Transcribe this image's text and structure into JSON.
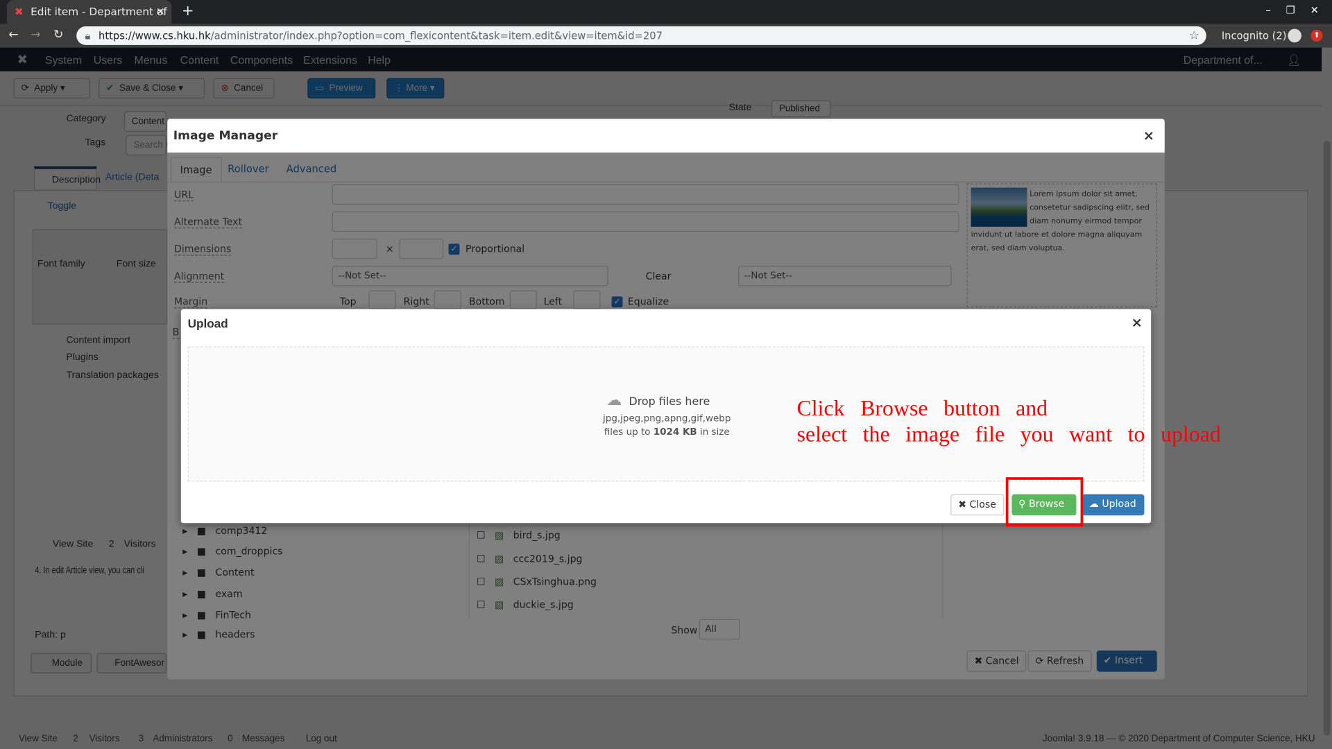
{
  "browser": {
    "tab_title": "Edit item - Department of",
    "new_tab": "+",
    "url_host": "https://www.cs.hku.hk",
    "url_path": "/administrator/index.php?option=com_flexicontent&task=item.edit&view=item&id=207",
    "profile": "Incognito (2)"
  },
  "nav": {
    "items": [
      "System",
      "Users",
      "Menus",
      "Content",
      "Components",
      "Extensions",
      "Help"
    ],
    "site": "Department of..."
  },
  "toolbar": {
    "apply": "Apply",
    "save_close": "Save & Close",
    "cancel": "Cancel",
    "preview": "Preview",
    "more": "More"
  },
  "form": {
    "category_label": "Category",
    "category_value": "Content",
    "tags_label": "Tags",
    "tags_placeholder": "Search /",
    "state_label": "State",
    "state_value": "Published",
    "tab_description": "Description",
    "tab_article": "Article (Deta",
    "toggle": "Toggle",
    "font_family": "Font family",
    "font_size": "Font size",
    "menu": [
      "Content import",
      "Plugins",
      "Translation packages"
    ],
    "view_site": "View Site",
    "visitors_count": "2",
    "visitors": "Visitors",
    "help_text": "4. In edit Article view, you can cli",
    "path": "Path: p",
    "module": "Module",
    "fontawesome": "FontAwesor"
  },
  "image_manager": {
    "title": "Image Manager",
    "tabs": [
      "Image",
      "Rollover",
      "Advanced"
    ],
    "url_label": "URL",
    "alt_label": "Alternate Text",
    "dimensions_label": "Dimensions",
    "times": "×",
    "proportional": "Proportional",
    "alignment_label": "Alignment",
    "alignment_value": "--Not Set--",
    "clear_label": "Clear",
    "clear_value": "--Not Set--",
    "margin_label": "Margin",
    "margin_parts": [
      "Top",
      "Right",
      "Bottom",
      "Left"
    ],
    "equalize": "Equalize",
    "border_label": "B",
    "preview_text": "Lorem ipsum dolor sit amet, consetetur sadipscing elitr, sed diam nonumy eirmod tempor invidunt ut labore et dolore magna aliquyam erat, sed diam voluptua.",
    "folders": [
      "comp3412",
      "com_droppics",
      "Content",
      "exam",
      "FinTech",
      "headers"
    ],
    "files": [
      "bird_s.jpg",
      "ccc2019_s.jpg",
      "CSxTsinghua.png",
      "duckie_s.jpg"
    ],
    "show_label": "Show",
    "show_value": "All",
    "cancel": "Cancel",
    "refresh": "Refresh",
    "insert": "Insert"
  },
  "upload": {
    "title": "Upload",
    "drop": "Drop files here",
    "types": "jpg,jpeg,png,apng,gif,webp",
    "size_pre": "files up to",
    "size_val": "1024 KB",
    "size_post": "in size",
    "close": "Close",
    "browse": "Browse",
    "upload": "Upload"
  },
  "annotation": {
    "line1": "Click Browse button and",
    "line2": "select the image file you want to upload",
    "color": "#ff0000"
  },
  "footer": {
    "view_site": "View Site",
    "visitors_n": "2",
    "visitors": "Visitors",
    "admins_n": "3",
    "admins": "Administrators",
    "messages_n": "0",
    "messages": "Messages",
    "logout": "Log out",
    "version": "Joomla! 3.9.18 — © 2020 Department of Computer Science, HKU"
  }
}
